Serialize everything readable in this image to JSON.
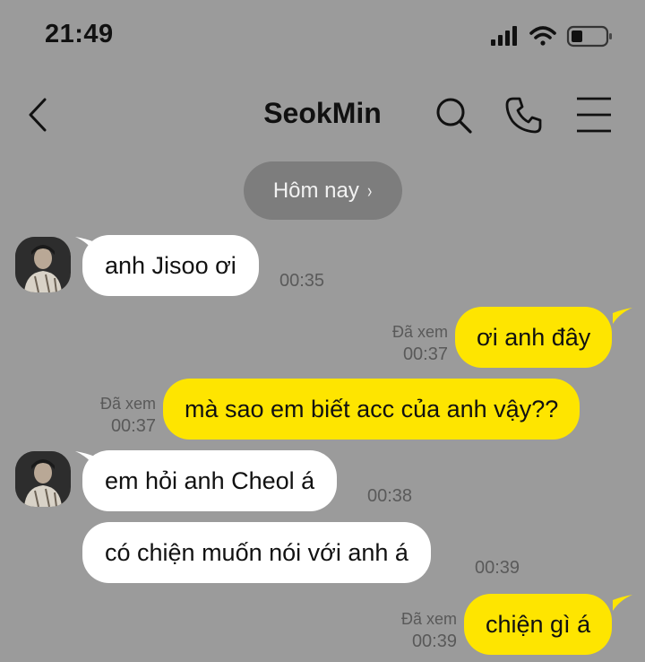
{
  "status_bar": {
    "time": "21:49"
  },
  "header": {
    "contact_name": "SeokMin"
  },
  "date_pill": {
    "label": "Hôm nay",
    "chevron": "›"
  },
  "messages": [
    {
      "text": "anh Jisoo ơi",
      "time": "00:35"
    },
    {
      "text": "ơi anh đây",
      "seen": "Đã xem",
      "time": "00:37"
    },
    {
      "text": "mà sao em biết acc của anh vậy??",
      "seen": "Đã xem",
      "time": "00:37"
    },
    {
      "text": "em hỏi anh Cheol á",
      "time": "00:38"
    },
    {
      "text": "có chiện muốn nói với anh á",
      "time": "00:39"
    },
    {
      "text": "chiện gì á",
      "seen": "Đã xem",
      "time": "00:39"
    }
  ],
  "colors": {
    "background": "#9b9b9b",
    "outgoing_bubble": "#fee500",
    "incoming_bubble": "#ffffff"
  },
  "icons": [
    "signal-icon",
    "wifi-icon",
    "battery-icon",
    "back-icon",
    "search-icon",
    "phone-icon",
    "menu-icon"
  ]
}
